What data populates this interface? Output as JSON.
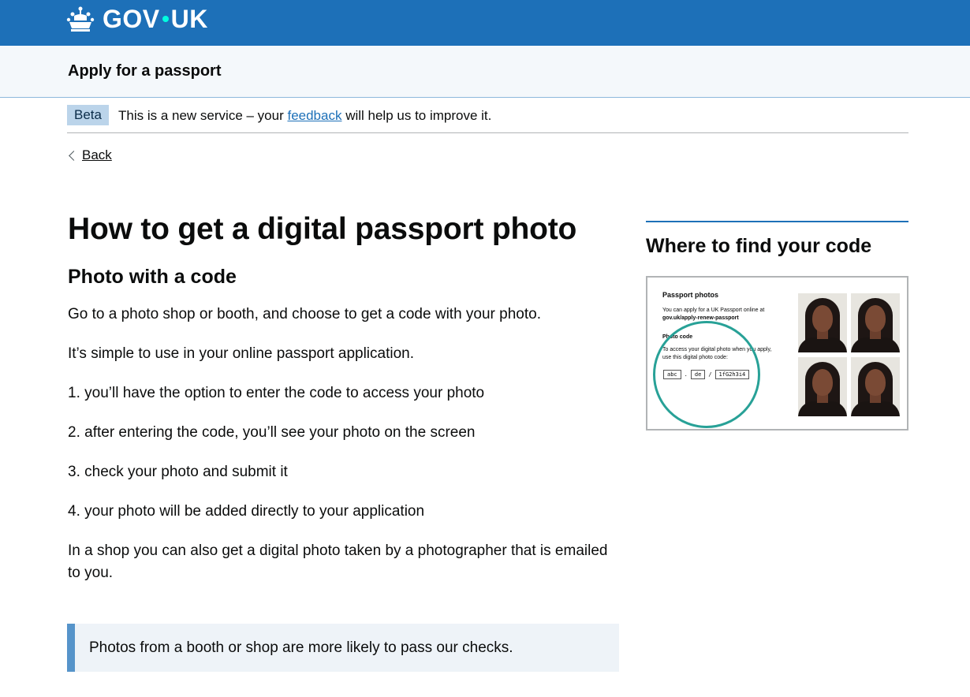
{
  "header": {
    "logo_text_left": "GOV",
    "logo_text_right": "UK",
    "brand_color": "#1d70b8"
  },
  "service": {
    "name": "Apply for a passport"
  },
  "phase_banner": {
    "tag": "Beta",
    "text_before": "This is a new service – your ",
    "link": "feedback",
    "text_after": " will help us to improve it."
  },
  "back_link": {
    "label": "Back"
  },
  "main": {
    "title": "How to get a digital passport photo",
    "section_heading": "Photo with a code",
    "paragraphs": [
      "Go to a photo shop or booth, and choose to get a code with your photo.",
      "It’s simple to use in your online passport application.",
      "1. you’ll have the option to enter the code to access your photo",
      "2. after entering the code, you’ll see your photo on the screen",
      "3. check your photo and submit it",
      "4. your photo will be added directly to your application",
      "In a shop you can also get a digital photo taken by a photographer that is emailed to you."
    ],
    "inset_text": "Photos from a booth or shop are more likely to pass our checks."
  },
  "aside": {
    "heading": "Where to find your code",
    "image": {
      "title": "Passport photos",
      "line1": "You can apply for a UK Passport online at",
      "line2": "gov.uk/apply-renew-passport",
      "subheading": "Photo code",
      "line3": "To access your digital photo when you apply,",
      "line4": "use this digital photo code:",
      "code_parts": [
        "abc",
        ".",
        "de",
        "/",
        "1fG2h3i4"
      ],
      "ring_color": "#28a197"
    }
  }
}
